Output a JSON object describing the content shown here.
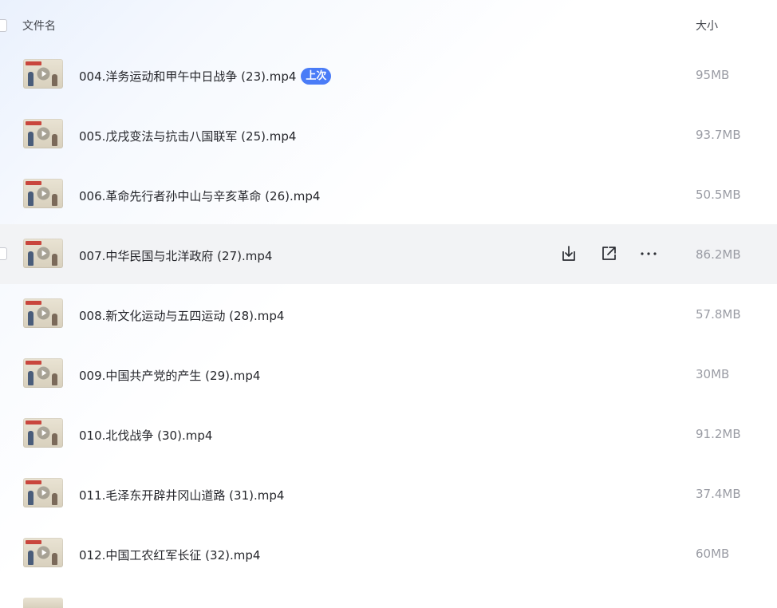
{
  "header": {
    "col_name": "文件名",
    "col_size": "大小"
  },
  "files": [
    {
      "name": "004.洋务运动和甲午中日战争 (23).mp4",
      "size": "95MB",
      "badge": "上次"
    },
    {
      "name": "005.戊戌变法与抗击八国联军 (25).mp4",
      "size": "93.7MB"
    },
    {
      "name": "006.革命先行者孙中山与辛亥革命 (26).mp4",
      "size": "50.5MB"
    },
    {
      "name": "007.中华民国与北洋政府 (27).mp4",
      "size": "86.2MB",
      "hovered": true
    },
    {
      "name": "008.新文化运动与五四运动 (28).mp4",
      "size": "57.8MB"
    },
    {
      "name": "009.中国共产党的产生 (29).mp4",
      "size": "30MB"
    },
    {
      "name": "010.北伐战争 (30).mp4",
      "size": "91.2MB"
    },
    {
      "name": "011.毛泽东开辟井冈山道路 (31).mp4",
      "size": "37.4MB"
    },
    {
      "name": "012.中国工农红军长征 (32).mp4",
      "size": "60MB"
    }
  ],
  "icons": {
    "download": "download-icon",
    "share": "share-icon",
    "more": "more-icon",
    "play": "play-icon"
  },
  "colors": {
    "badge": "#4a7cf7",
    "hover_row": "#f2f3f5",
    "size_text": "#9a9ca4"
  }
}
